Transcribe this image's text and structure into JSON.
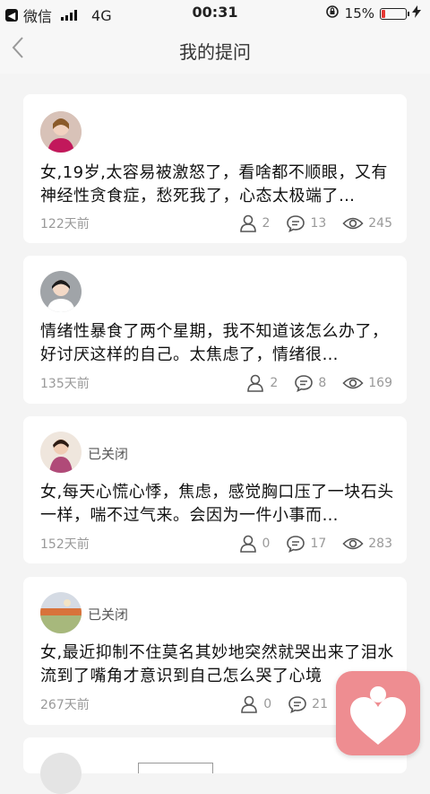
{
  "status_bar": {
    "carrier": "微信",
    "network": "4G",
    "time": "00:31",
    "battery_percent": "15%",
    "battery_level": 0.15
  },
  "header": {
    "title": "我的提问"
  },
  "questions": [
    {
      "closed": "",
      "text": "女,19岁,太容易被激怒了，看啥都不顺眼，又有神经性贪食症，愁死我了，心态太极端了…",
      "time": "122天前",
      "answers": "2",
      "comments": "13",
      "views": "245"
    },
    {
      "closed": "",
      "text": "情绪性暴食了两个星期，我不知道该怎么办了，好讨厌这样的自己。太焦虑了，情绪很…",
      "time": "135天前",
      "answers": "2",
      "comments": "8",
      "views": "169"
    },
    {
      "closed": "已关闭",
      "text": "女,每天心慌心悸，焦虑，感觉胸口压了一块石头一样，喘不过气来。会因为一件小事而…",
      "time": "152天前",
      "answers": "0",
      "comments": "17",
      "views": "283"
    },
    {
      "closed": "已关闭",
      "text": "女,最近抑制不住莫名其妙地突然就哭出来了泪水流到了嘴角才意识到自己怎么哭了心境",
      "time": "267天前",
      "answers": "0",
      "comments": "21",
      "views": ""
    }
  ],
  "colors": {
    "accent_fab": "#ee8d91",
    "battery_low": "#e53935"
  }
}
